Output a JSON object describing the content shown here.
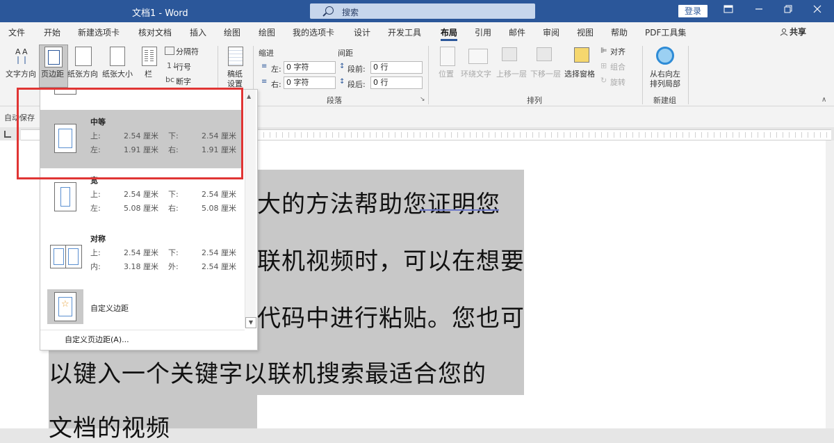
{
  "title_bar": {
    "doc_title": "文档1  -  Word",
    "search_placeholder": "搜索",
    "login_label": "登录"
  },
  "tabs": [
    "文件",
    "开始",
    "新建选项卡",
    "核对文档",
    "插入",
    "绘图",
    "绘图",
    "我的选项卡",
    "设计",
    "开发工具",
    "布局",
    "引用",
    "邮件",
    "审阅",
    "视图",
    "帮助",
    "PDF工具集"
  ],
  "active_tab": "布局",
  "share_label": "共享",
  "ribbon": {
    "page_setup": {
      "text_direction": "文字方向",
      "margins": "页边距",
      "orientation": "纸张方向",
      "size": "纸张大小",
      "columns": "栏",
      "breaks": "分隔符",
      "line_numbers": "行号",
      "hyphenation": "断字"
    },
    "draft": {
      "line1": "稿纸",
      "line2": "设置"
    },
    "paragraph": {
      "indent_label": "缩进",
      "spacing_label": "间距",
      "left_label": "左:",
      "right_label": "右:",
      "before_label": "段前:",
      "after_label": "段后:",
      "left_value": "0 字符",
      "right_value": "0 字符",
      "before_value": "0 行",
      "after_value": "0 行",
      "group_label": "段落"
    },
    "arrange": {
      "position": "位置",
      "wrap_text": "环绕文字",
      "bring_forward": "上移一层",
      "send_backward": "下移一层",
      "selection_pane": "选择窗格",
      "align": "对齐",
      "group": "组合",
      "rotate": "旋转",
      "group_label": "排列"
    },
    "new_group": {
      "rtl_line1": "从右向左",
      "rtl_line2": "排列局部",
      "group_label": "新建组"
    }
  },
  "autosave_label": "自动保存",
  "margins_dropdown": {
    "options": [
      {
        "name": "中等",
        "k1": "上:",
        "v1": "2.54 厘米",
        "k2": "下:",
        "v2": "2.54 厘米",
        "k3": "左:",
        "v3": "1.91 厘米",
        "k4": "右:",
        "v4": "1.91 厘米"
      },
      {
        "name": "宽",
        "k1": "上:",
        "v1": "2.54 厘米",
        "k2": "下:",
        "v2": "2.54 厘米",
        "k3": "左:",
        "v3": "5.08 厘米",
        "k4": "右:",
        "v4": "5.08 厘米"
      },
      {
        "name": "对称",
        "k1": "上:",
        "v1": "2.54 厘米",
        "k2": "下:",
        "v2": "2.54 厘米",
        "k3": "内:",
        "v3": "3.18 厘米",
        "k4": "外:",
        "v4": "2.54 厘米"
      }
    ],
    "custom_last": "自定义边距",
    "custom_margins_link": "自定义页边距(A)..."
  },
  "document": {
    "lines": [
      "大的方法帮助您证明您",
      "联机视频时，可以在想要",
      "代码中进行粘贴。您也可",
      "以键入一个关键字以联机搜索最适合您的",
      "文档的视频"
    ]
  }
}
